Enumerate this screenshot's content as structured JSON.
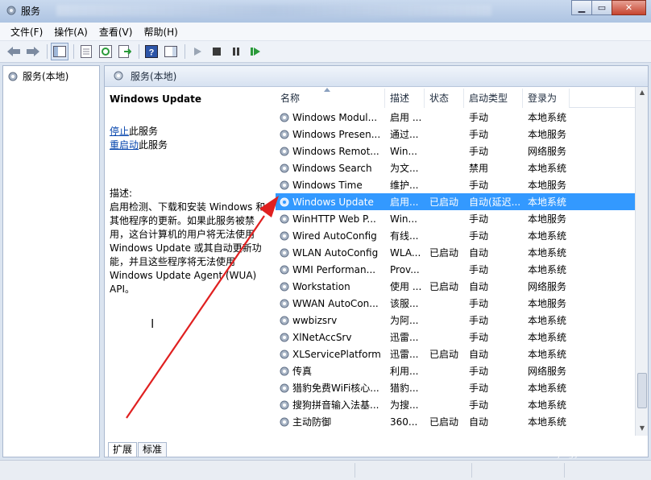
{
  "window": {
    "title": "服务"
  },
  "menu": [
    "文件(F)",
    "操作(A)",
    "查看(V)",
    "帮助(H)"
  ],
  "tree": {
    "root": "服务(本地)"
  },
  "panel": {
    "title": "服务(本地)"
  },
  "detail": {
    "service_name": "Windows Update",
    "stop_link": "停止",
    "stop_suffix": "此服务",
    "restart_link": "重启动",
    "restart_suffix": "此服务",
    "desc_label": "描述:",
    "desc_text": "启用检测、下载和安装 Windows 和其他程序的更新。如果此服务被禁用，这台计算机的用户将无法使用 Windows Update 或其自动更新功能，并且这些程序将无法使用 Windows Update Agent (WUA) API。"
  },
  "columns": [
    "名称",
    "描述",
    "状态",
    "启动类型",
    "登录为"
  ],
  "services": [
    {
      "name": "Windows Modul...",
      "desc": "启用 ...",
      "status": "",
      "startup": "手动",
      "logon": "本地系统"
    },
    {
      "name": "Windows Presen...",
      "desc": "通过...",
      "status": "",
      "startup": "手动",
      "logon": "本地服务"
    },
    {
      "name": "Windows Remot...",
      "desc": "Win...",
      "status": "",
      "startup": "手动",
      "logon": "网络服务"
    },
    {
      "name": "Windows Search",
      "desc": "为文...",
      "status": "",
      "startup": "禁用",
      "logon": "本地系统"
    },
    {
      "name": "Windows Time",
      "desc": "维护...",
      "status": "",
      "startup": "手动",
      "logon": "本地服务"
    },
    {
      "name": "Windows Update",
      "desc": "启用...",
      "status": "已启动",
      "startup": "自动(延迟...",
      "logon": "本地系统",
      "selected": true
    },
    {
      "name": "WinHTTP Web P...",
      "desc": "Win...",
      "status": "",
      "startup": "手动",
      "logon": "本地服务"
    },
    {
      "name": "Wired AutoConfig",
      "desc": "有线...",
      "status": "",
      "startup": "手动",
      "logon": "本地系统"
    },
    {
      "name": "WLAN AutoConfig",
      "desc": "WLA...",
      "status": "已启动",
      "startup": "自动",
      "logon": "本地系统"
    },
    {
      "name": "WMI Performan...",
      "desc": "Prov...",
      "status": "",
      "startup": "手动",
      "logon": "本地系统"
    },
    {
      "name": "Workstation",
      "desc": "使用 ...",
      "status": "已启动",
      "startup": "自动",
      "logon": "网络服务"
    },
    {
      "name": "WWAN AutoCon...",
      "desc": "该服...",
      "status": "",
      "startup": "手动",
      "logon": "本地服务"
    },
    {
      "name": "wwbizsrv",
      "desc": "为阿...",
      "status": "",
      "startup": "手动",
      "logon": "本地系统"
    },
    {
      "name": "XlNetAccSrv",
      "desc": "迅雷...",
      "status": "",
      "startup": "手动",
      "logon": "本地系统"
    },
    {
      "name": "XLServicePlatform",
      "desc": "迅雷...",
      "status": "已启动",
      "startup": "自动",
      "logon": "本地系统"
    },
    {
      "name": "传真",
      "desc": "利用...",
      "status": "",
      "startup": "手动",
      "logon": "网络服务"
    },
    {
      "name": "猎豹免费WiFi核心...",
      "desc": "猎豹...",
      "status": "",
      "startup": "手动",
      "logon": "本地系统"
    },
    {
      "name": "搜狗拼音输入法基...",
      "desc": "为搜...",
      "status": "",
      "startup": "手动",
      "logon": "本地系统"
    },
    {
      "name": "主动防御",
      "desc": "360...",
      "status": "已启动",
      "startup": "自动",
      "logon": "本地系统"
    }
  ],
  "tabs": [
    "扩展",
    "标准"
  ],
  "watermark": {
    "brand": "Baidu经验",
    "url": "jingyan.baidu.com"
  },
  "colors": {
    "selection": "#3399ff",
    "link": "#0645ad",
    "annotation_arrow": "#e02020"
  }
}
